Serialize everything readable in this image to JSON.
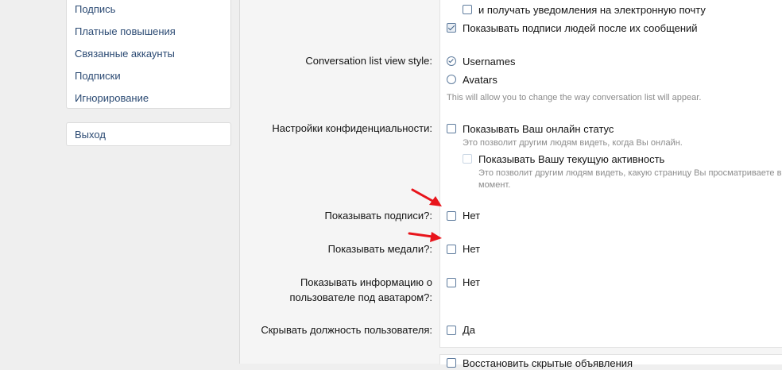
{
  "sidebar": {
    "items": [
      {
        "label": "Подпись"
      },
      {
        "label": "Платные повышения"
      },
      {
        "label": "Связанные аккаунты"
      },
      {
        "label": "Подписки"
      },
      {
        "label": "Игнорирование"
      }
    ],
    "logout_label": "Выход"
  },
  "form": {
    "email_notify": {
      "label": "и получать уведомления на электронную почту",
      "checked": false
    },
    "show_signatures_after": {
      "label": "Показывать подписи людей после их сообщений",
      "checked": true
    },
    "conversation_style": {
      "label": "Conversation list view style:",
      "options": [
        {
          "label": "Usernames",
          "selected": true
        },
        {
          "label": "Avatars",
          "selected": false
        }
      ],
      "hint": "This will allow you to change the way conversation list will appear."
    },
    "privacy": {
      "label": "Настройки конфиденциальности:",
      "online_status": {
        "label": "Показывать Ваш онлайн статус",
        "checked": false,
        "hint": "Это позволит другим людям видеть, когда Вы онлайн."
      },
      "activity": {
        "label": "Показывать Вашу текущую активность",
        "checked": false,
        "hint_line1": "Это позволит другим людям видеть, какую страницу Вы просматриваете в д",
        "hint_line2": "момент."
      }
    },
    "show_signatures": {
      "label": "Показывать подписи?:",
      "option": "Нет",
      "checked": false
    },
    "show_medals": {
      "label": "Показывать медали?:",
      "option": "Нет",
      "checked": false
    },
    "show_user_info": {
      "label_line1": "Показывать информацию о",
      "label_line2": "пользователе под аватаром?:",
      "option": "Нет",
      "checked": false
    },
    "hide_user_title": {
      "label": "Скрывать должность пользователя:",
      "option": "Да",
      "checked": false
    },
    "restore_hidden": {
      "label": "Восстановить скрытые объявления",
      "checked": false
    }
  },
  "colors": {
    "arrow": "#e8141b",
    "link": "#2b4a73"
  },
  "annotations": [
    {
      "icon": "red-arrow-icon"
    },
    {
      "icon": "red-arrow-icon"
    }
  ]
}
